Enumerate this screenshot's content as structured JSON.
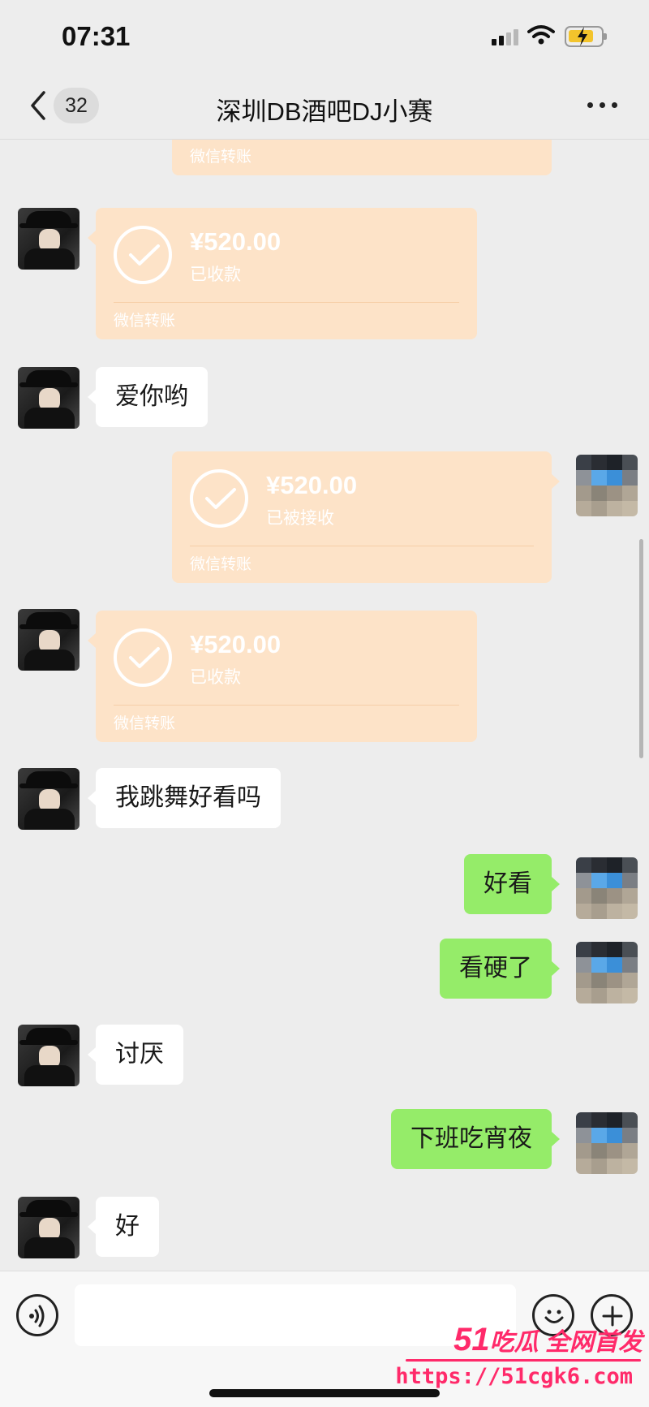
{
  "status_bar": {
    "time": "07:31"
  },
  "header": {
    "back_badge": "32",
    "title": "深圳DB酒吧DJ小赛"
  },
  "chat": {
    "messages": [
      {
        "kind": "transfer-partial",
        "side": "right",
        "footer": "微信转账"
      },
      {
        "kind": "transfer",
        "side": "left",
        "amount": "¥520.00",
        "status": "已收款",
        "footer": "微信转账"
      },
      {
        "kind": "text",
        "side": "left",
        "text": "爱你哟"
      },
      {
        "kind": "transfer",
        "side": "right",
        "amount": "¥520.00",
        "status": "已被接收",
        "footer": "微信转账"
      },
      {
        "kind": "transfer",
        "side": "left",
        "amount": "¥520.00",
        "status": "已收款",
        "footer": "微信转账"
      },
      {
        "kind": "text",
        "side": "left",
        "text": "我跳舞好看吗"
      },
      {
        "kind": "text",
        "side": "right",
        "text": "好看"
      },
      {
        "kind": "text",
        "side": "right",
        "text": "看硬了"
      },
      {
        "kind": "text",
        "side": "left",
        "text": "讨厌"
      },
      {
        "kind": "text",
        "side": "right",
        "text": "下班吃宵夜"
      },
      {
        "kind": "text",
        "side": "left",
        "text": "好"
      }
    ]
  },
  "input_bar": {
    "voice_icon": "voice-icon",
    "emoji_icon": "emoji-icon",
    "plus_icon": "plus-icon"
  },
  "watermark": {
    "brand_num": "51",
    "brand_text": "吃瓜 全网首发",
    "url": "https://51cgk6.com"
  },
  "colors": {
    "background": "#ededed",
    "sent_bubble": "#95ec69",
    "received_bubble": "#ffffff",
    "transfer_bubble": "#fde3c8",
    "watermark": "#ff2a6a"
  }
}
